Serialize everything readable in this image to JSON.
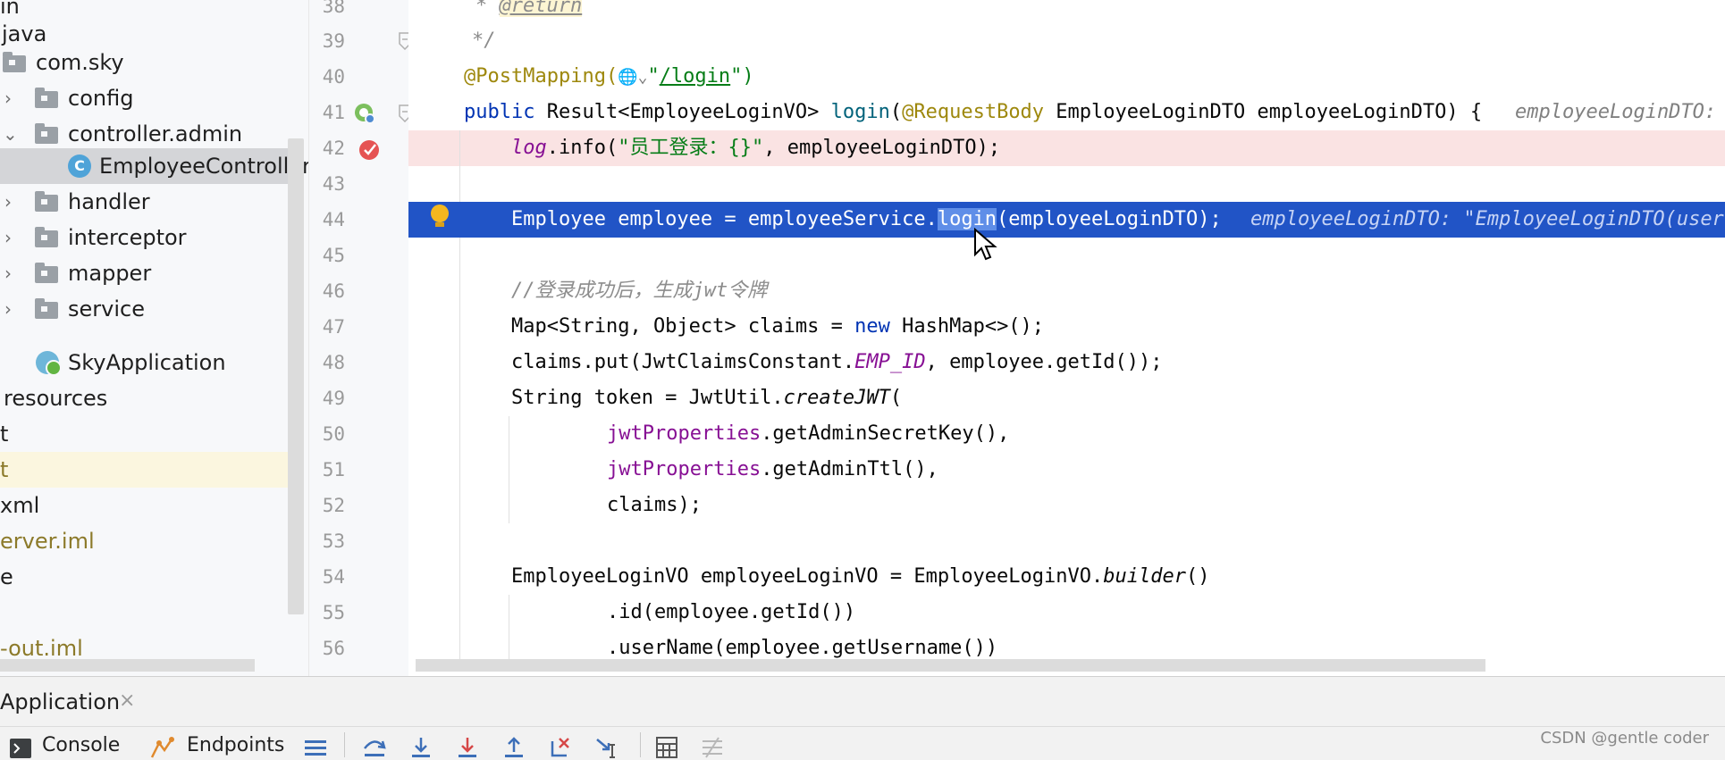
{
  "project_tree": {
    "items": [
      {
        "label": "in"
      },
      {
        "label": "java"
      },
      {
        "label": "com.sky"
      },
      {
        "label": "config"
      },
      {
        "label": "controller.admin"
      },
      {
        "label": "EmployeeController"
      },
      {
        "label": "handler"
      },
      {
        "label": "interceptor"
      },
      {
        "label": "mapper"
      },
      {
        "label": "service"
      },
      {
        "label": "SkyApplication"
      },
      {
        "label": "resources"
      },
      {
        "label": "t"
      },
      {
        "label": "t"
      },
      {
        "label": "xml"
      },
      {
        "label": "erver.iml"
      },
      {
        "label": "e"
      },
      {
        "label": "-out.iml"
      }
    ],
    "selected": "EmployeeController",
    "class_icon_letter": "C"
  },
  "gutter": {
    "line_numbers": [
      "38",
      "39",
      "40",
      "41",
      "42",
      "43",
      "44",
      "45",
      "46",
      "47",
      "48",
      "49",
      "50",
      "51",
      "52",
      "53",
      "54",
      "55",
      "56"
    ]
  },
  "code": {
    "l38": {
      "star": "* ",
      "tag": "@return"
    },
    "l39": {
      "text": "*/"
    },
    "l40": {
      "ann": "@PostMapping(",
      "sep": "\"",
      "url": "/login",
      "end": "\")",
      "globe": "🌐⌄"
    },
    "l41": {
      "kw": "public",
      "a": " Result<EmployeeLoginVO> ",
      "m": "login",
      "b": "(",
      "ann": "@RequestBody",
      "c": " EmployeeLoginDTO employeeLoginDTO) {",
      "hint": "employeeLoginDTO:"
    },
    "l42": {
      "log": "log",
      "a": ".info(",
      "str": "\"员工登录：{}\"",
      "b": ", employeeLoginDTO);"
    },
    "l44": {
      "a": "Employee employee = employeeService.",
      "sel": "login",
      "b": "(employeeLoginDTO);",
      "hint": "employeeLoginDTO: \"EmployeeLoginDTO(user"
    },
    "l46": {
      "cmt": "//登录成功后，生成jwt令牌"
    },
    "l47": {
      "a": "Map<String, Object> claims = ",
      "kw": "new",
      "b": " HashMap<>();"
    },
    "l48": {
      "a": "claims.put(JwtClaimsConstant.",
      "f": "EMP_ID",
      "b": ", employee.getId());"
    },
    "l49": {
      "a": "String token = JwtUtil.",
      "m": "createJWT",
      "b": "("
    },
    "l50": {
      "f": "jwtProperties",
      "b": ".getAdminSecretKey(),"
    },
    "l51": {
      "f": "jwtProperties",
      "b": ".getAdminTtl(),"
    },
    "l52": {
      "text": "claims);"
    },
    "l54": {
      "a": "EmployeeLoginVO employeeLoginVO = EmployeeLoginVO.",
      "m": "builder",
      "b": "()"
    },
    "l55": {
      "text": ".id(employee.getId())"
    },
    "l56": {
      "text": ".userName(employee.getUsername())"
    }
  },
  "bottom_panel": {
    "run_tab_label": "Application",
    "run_tab_close": "×",
    "console_label": "Console",
    "endpoints_label": "Endpoints"
  },
  "watermark": "CSDN @gentle coder",
  "colors": {
    "execution_line": "#2154c6",
    "breakpoint_line": "#fae3e3",
    "breakpoint_icon": "#e55353",
    "keyword": "#0033b3",
    "annotation": "#9e880d",
    "string": "#067d17",
    "field": "#871094"
  }
}
